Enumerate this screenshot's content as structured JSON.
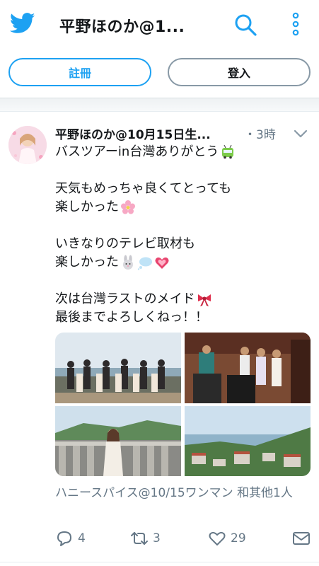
{
  "header": {
    "title": "平野ほのか@1...",
    "logo_icon": "twitter-bird-icon",
    "search_icon": "search-icon",
    "more_icon": "more-vertical-icon"
  },
  "buttons": {
    "register": "註冊",
    "login": "登入"
  },
  "tweet": {
    "author": "平野ほのか@10月15日生...",
    "time": "・3時",
    "lines": [
      "バスツアーin台灣ありがとう",
      "天気もめっちゃ良くてとっても",
      "楽しかった",
      "いきなりのテレビ取材も",
      "楽しかった",
      "次は台灣ラストのメイド",
      "最後までよろしくねっ！！"
    ],
    "with_text": "ハニースパイス@10/15ワンマン 和其他1人",
    "reply_count": "4",
    "retweet_count": "3",
    "like_count": "29"
  },
  "colors": {
    "accent": "#1da1f2",
    "secondary_text": "#657786"
  }
}
